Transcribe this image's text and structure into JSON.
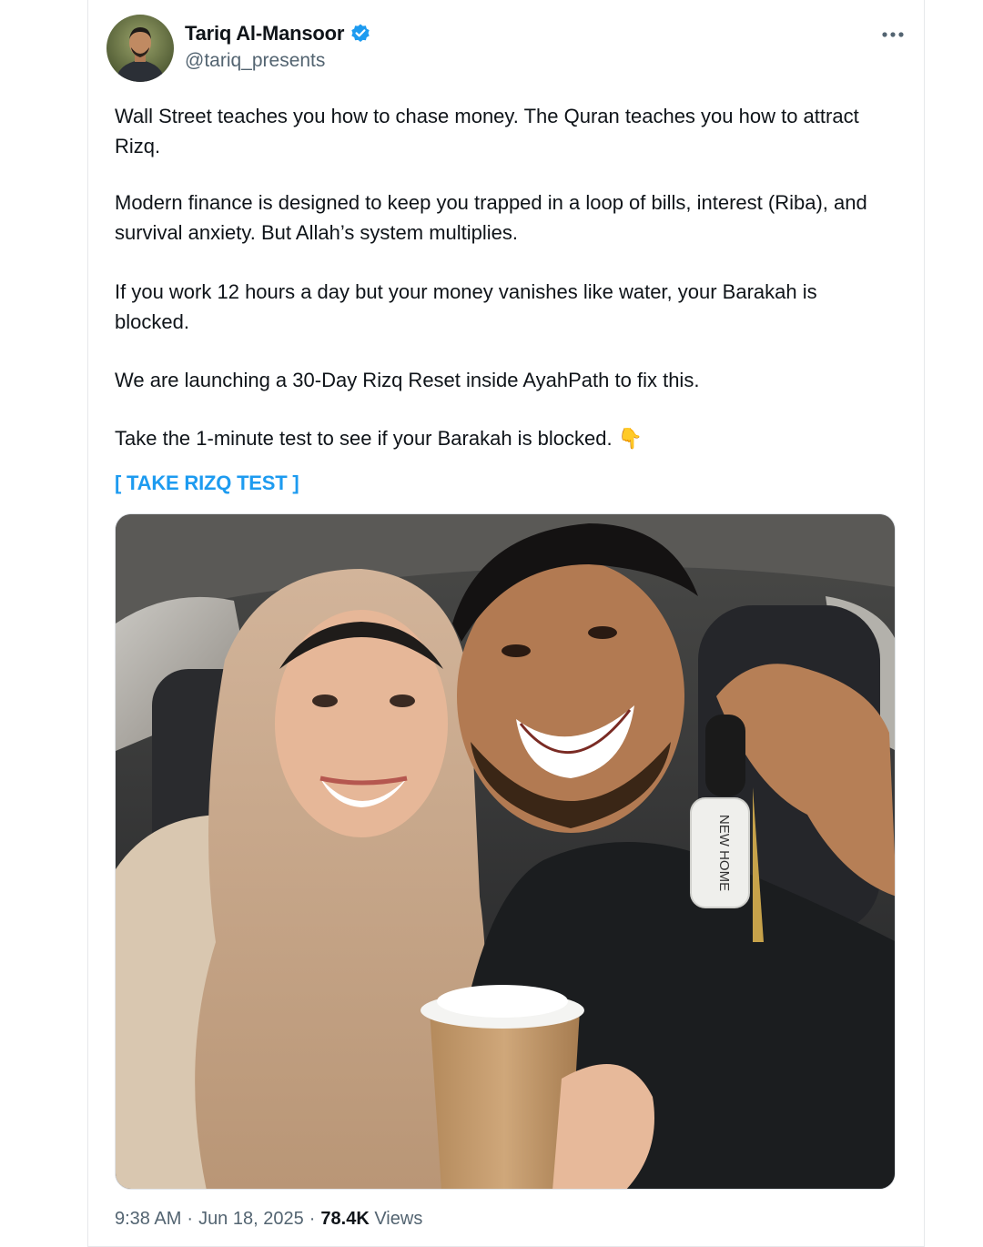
{
  "author": {
    "name": "Tariq Al-Mansoor",
    "handle": "@tariq_presents",
    "verified": true
  },
  "tweet": {
    "paragraphs": [
      "Wall Street teaches you how to chase money. The Quran teaches you how to attract Rizq.",
      "Modern finance is designed to keep you trapped in a loop of bills, interest (Riba), and survival anxiety. But Allah’s system multiplies.",
      "If you work 12 hours a day but your money vanishes like water, your Barakah is blocked.",
      "We are launching a 30-Day Rizq Reset inside AyahPath to fix this.",
      "Take the 1-minute test to see if your Barakah is blocked. 👇"
    ],
    "link_label": "[ TAKE RIZQ TEST ]",
    "keytag_text": "NEW HOME"
  },
  "meta": {
    "time": "9:38 AM",
    "sep1": "·",
    "date": "Jun 18, 2025",
    "sep2": "·",
    "views_count": "78.4K",
    "views_label": "Views"
  },
  "colors": {
    "accent": "#1d9bf0",
    "secondary_text": "#536471",
    "primary_text": "#0f1419"
  },
  "icons": [
    "verified-badge-icon",
    "more-options-icon"
  ]
}
